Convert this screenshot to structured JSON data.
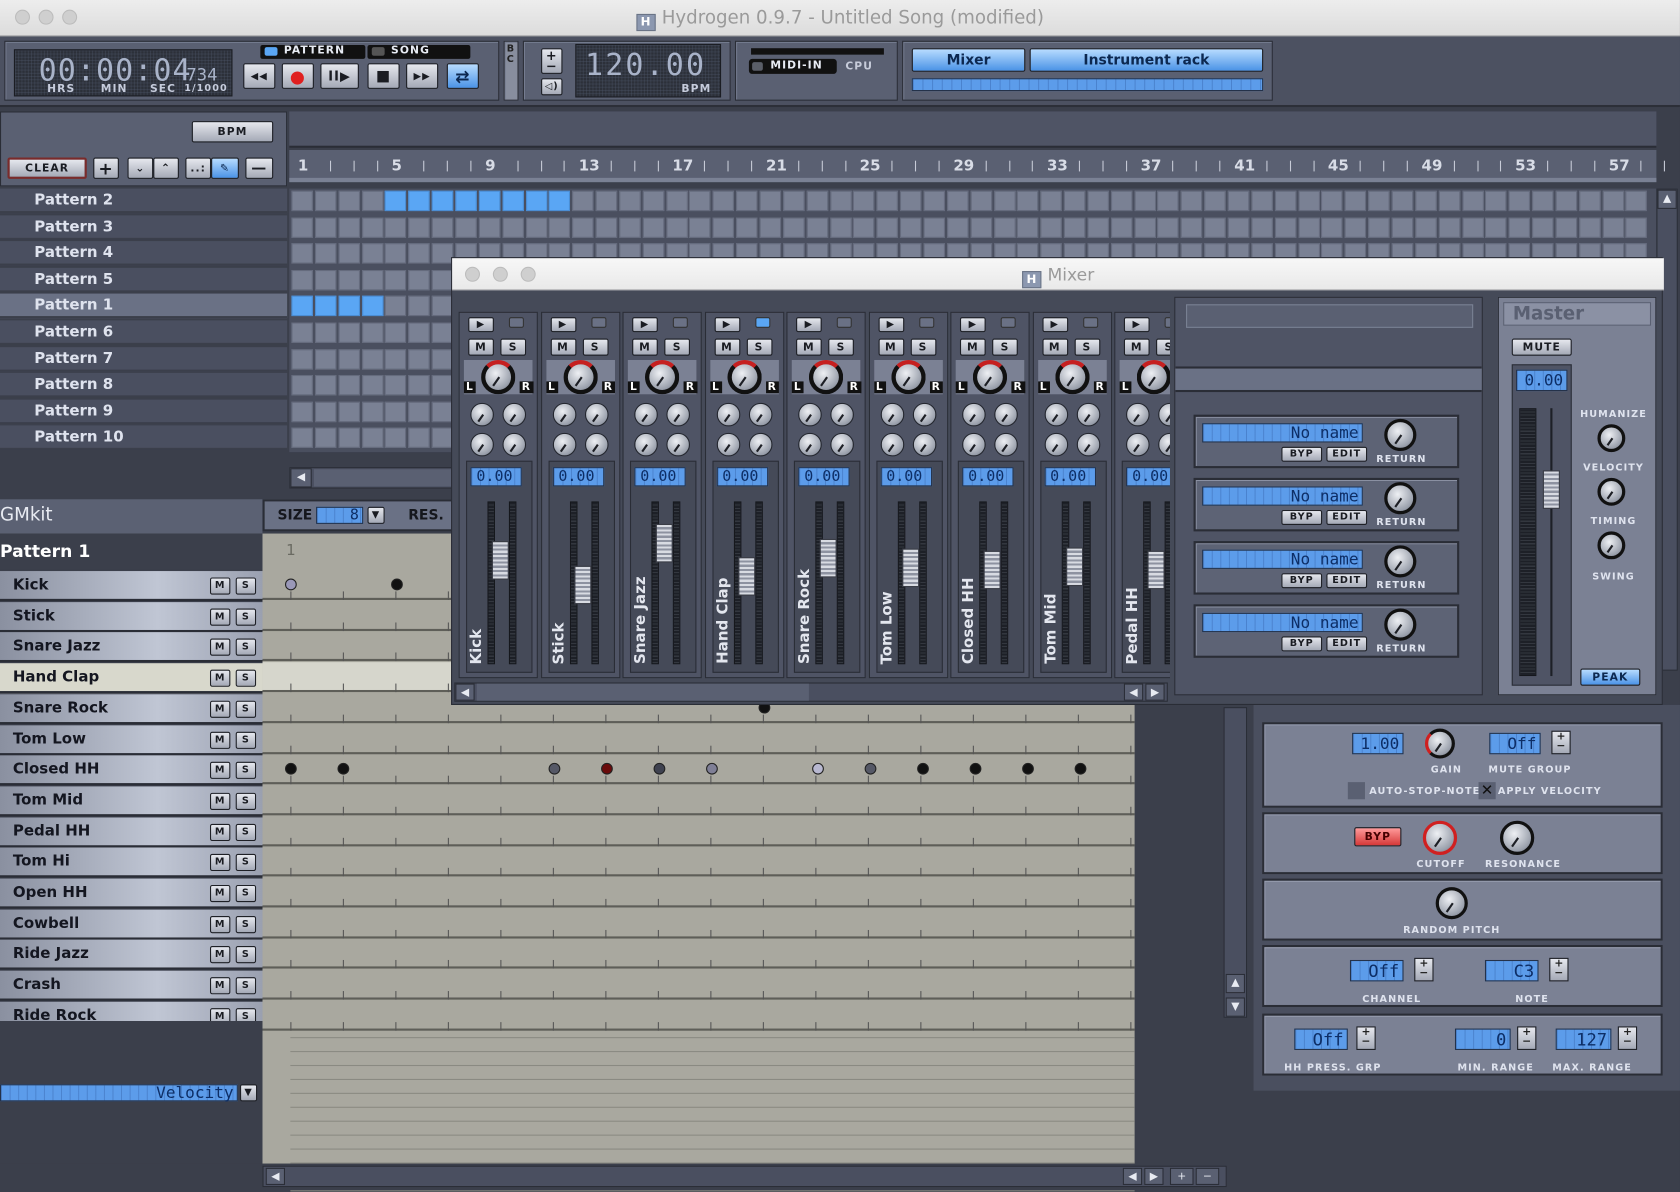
{
  "window": {
    "title": "Hydrogen 0.9.7 - Untitled Song (modified)"
  },
  "transport": {
    "time": "00:00:04",
    "millis": "734",
    "time_labels": [
      "HRS",
      "MIN",
      "SEC",
      "1/1000"
    ],
    "mode_pattern": "PATTERN",
    "mode_song": "SONG",
    "bpm": "120.00",
    "bpm_label": "BPM",
    "bc_label": "B C",
    "midi_in": "MIDI-IN",
    "cpu": "CPU",
    "mixer_btn": "Mixer",
    "rack_btn": "Instrument rack"
  },
  "song_editor": {
    "bpm_btn": "BPM",
    "clear_btn": "CLEAR",
    "ruler": [
      "1",
      "5",
      "9",
      "13",
      "17",
      "21",
      "25",
      "29",
      "33",
      "37",
      "41",
      "45",
      "49",
      "53",
      "57"
    ],
    "patterns": [
      {
        "name": "Pattern 2",
        "on": [
          5,
          6,
          7,
          8,
          9,
          10,
          11,
          12
        ]
      },
      {
        "name": "Pattern 3",
        "on": []
      },
      {
        "name": "Pattern 4",
        "on": []
      },
      {
        "name": "Pattern 5",
        "on": []
      },
      {
        "name": "Pattern 1",
        "on": [
          1,
          2,
          3,
          4
        ],
        "selected": true
      },
      {
        "name": "Pattern 6",
        "on": []
      },
      {
        "name": "Pattern 7",
        "on": []
      },
      {
        "name": "Pattern 8",
        "on": []
      },
      {
        "name": "Pattern 9",
        "on": []
      },
      {
        "name": "Pattern 10",
        "on": []
      }
    ]
  },
  "pattern_editor": {
    "kit": "GMkit",
    "pattern": "Pattern 1",
    "size_label": "SIZE",
    "size_value": "8",
    "res_label": "RES.",
    "ruler_first": "1",
    "mute_label": "M",
    "solo_label": "S",
    "instruments": [
      "Kick",
      "Stick",
      "Snare Jazz",
      "Hand Clap",
      "Snare Rock",
      "Tom Low",
      "Closed HH",
      "Tom Mid",
      "Pedal HH",
      "Tom Hi",
      "Open HH",
      "Cowbell",
      "Ride Jazz",
      "Crash",
      "Ride Rock"
    ],
    "selected_instrument": "Hand Clap",
    "property_select": "Velocity"
  },
  "mixer": {
    "title": "Mixer",
    "strips": [
      {
        "name": "Kick",
        "value": "0.00",
        "fader": 0.68
      },
      {
        "name": "Stick",
        "value": "0.00",
        "fader": 0.48
      },
      {
        "name": "Snare Jazz",
        "value": "0.00",
        "fader": 0.82
      },
      {
        "name": "Hand Clap",
        "value": "0.00",
        "fader": 0.55
      },
      {
        "name": "Snare Rock",
        "value": "0.00",
        "fader": 0.7
      },
      {
        "name": "Tom Low",
        "value": "0.00",
        "fader": 0.62
      },
      {
        "name": "Closed HH",
        "value": "0.00",
        "fader": 0.6
      },
      {
        "name": "Tom Mid",
        "value": "0.00",
        "fader": 0.63
      },
      {
        "name": "Pedal HH",
        "value": "0.00",
        "fader": 0.6
      }
    ],
    "strip_labels": {
      "mute": "M",
      "solo": "S",
      "left": "L",
      "right": "R"
    },
    "fx": [
      {
        "name": "No name",
        "bypass": "BYP",
        "edit": "EDIT",
        "return": "RETURN"
      },
      {
        "name": "No name",
        "bypass": "BYP",
        "edit": "EDIT",
        "return": "RETURN"
      },
      {
        "name": "No name",
        "bypass": "BYP",
        "edit": "EDIT",
        "return": "RETURN"
      },
      {
        "name": "No name",
        "bypass": "BYP",
        "edit": "EDIT",
        "return": "RETURN"
      }
    ],
    "master": {
      "title": "Master",
      "mute": "MUTE",
      "value": "0.00",
      "humanize": "HUMANIZE",
      "velocity": "VELOCITY",
      "timing": "TIMING",
      "swing": "SWING",
      "peak": "PEAK"
    }
  },
  "instrument_rack": {
    "gain_value": "1.00",
    "gain_label": "GAIN",
    "mute_group_value": "Off",
    "mute_group_label": "MUTE GROUP",
    "auto_stop_note": "AUTO-STOP-NOTE",
    "apply_velocity": "APPLY VELOCITY",
    "bypass": "BYP",
    "cutoff": "CUTOFF",
    "resonance": "RESONANCE",
    "random_pitch": "RANDOM PITCH",
    "channel_value": "Off",
    "channel_label": "CHANNEL",
    "note_value": "C3",
    "note_label": "NOTE",
    "hh_value": "Off",
    "hh_label": "HH PRESS. GRP",
    "min_value": "0",
    "min_label": "MIN. RANGE",
    "max_value": "127",
    "max_label": "MAX. RANGE"
  },
  "colors": {
    "accent": "#5aa6f4",
    "record": "#e02020"
  }
}
